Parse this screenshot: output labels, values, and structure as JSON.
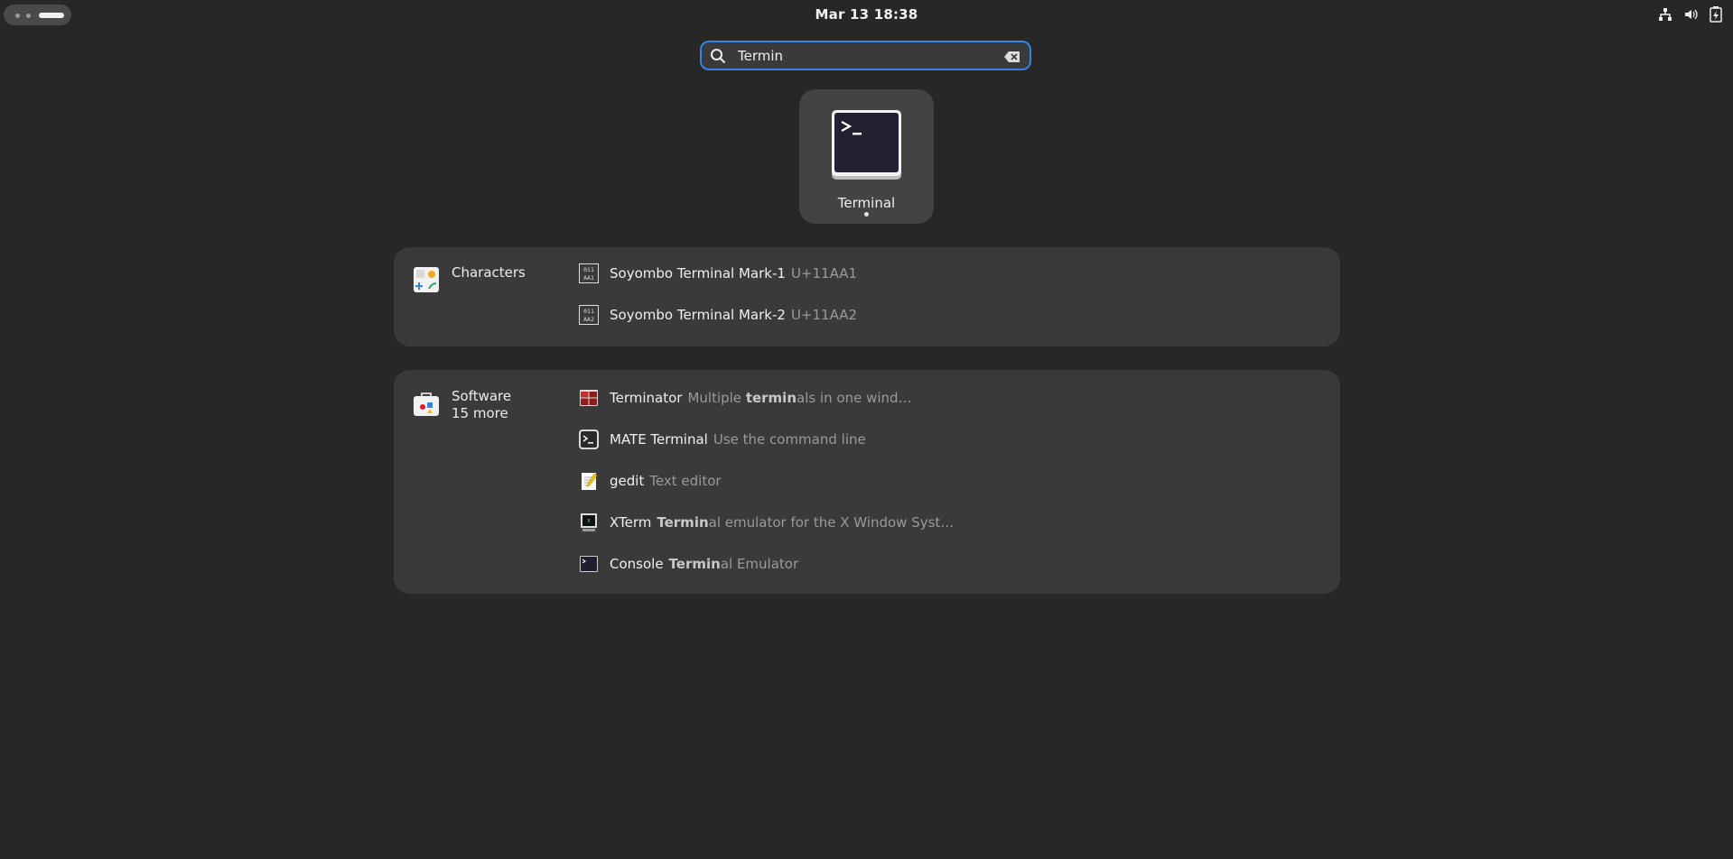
{
  "topbar": {
    "clock": "Mar 13  18:38",
    "icons": [
      "network-icon",
      "volume-icon",
      "battery-icon"
    ]
  },
  "search": {
    "value": "Termin",
    "icons": [
      "search-icon",
      "clear-icon"
    ]
  },
  "app_results": [
    {
      "name": "Terminal",
      "icon": "terminal-icon",
      "running": true
    }
  ],
  "providers": [
    {
      "name": "Characters",
      "more": "",
      "icon": "characters-app-icon",
      "results": [
        {
          "name": "Soyombo Terminal Mark-1",
          "desc": "U+11AA1",
          "icon_text": "011\nAA1"
        },
        {
          "name": "Soyombo Terminal Mark-2",
          "desc": "U+11AA2",
          "icon_text": "011\nAA2"
        }
      ]
    },
    {
      "name": "Software",
      "more": "15 more",
      "icon": "software-app-icon",
      "results": [
        {
          "name": "Terminator",
          "desc_pre": "Multiple ",
          "desc_bold": "termin",
          "desc_post": "als in one wind…",
          "icon": "terminator-icon"
        },
        {
          "name": "MATE Terminal",
          "desc_pre": "Use the command line",
          "desc_bold": "",
          "desc_post": "",
          "icon": "mate-terminal-icon"
        },
        {
          "name": "gedit",
          "desc_pre": "Text editor",
          "desc_bold": "",
          "desc_post": "",
          "icon": "gedit-icon"
        },
        {
          "name": "XTerm",
          "desc_pre": "",
          "desc_bold": "Termin",
          "desc_post": "al emulator for the X Window Syst…",
          "icon": "xterm-icon"
        },
        {
          "name": "Console",
          "desc_pre": "",
          "desc_bold": "Termin",
          "desc_post": "al Emulator",
          "icon": "console-icon"
        }
      ]
    }
  ],
  "colors": {
    "accent": "#3584e4",
    "background": "#272727",
    "panel": "#3a3a3a"
  }
}
